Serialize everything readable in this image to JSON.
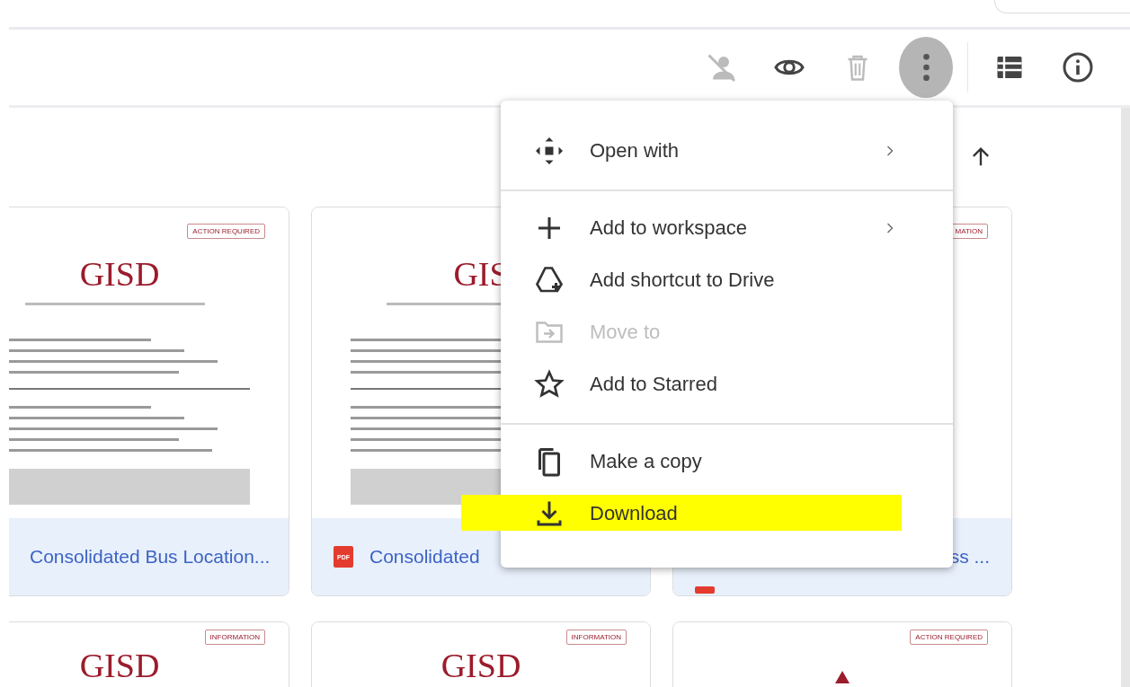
{
  "toolbar": {
    "buttons": [
      {
        "kind": "person-off",
        "disabled": true,
        "active": false
      },
      {
        "kind": "eye",
        "disabled": false,
        "active": false
      },
      {
        "kind": "trash",
        "disabled": true,
        "active": false
      },
      {
        "kind": "more",
        "disabled": false,
        "active": true
      },
      {
        "kind": "list",
        "disabled": false,
        "active": false
      },
      {
        "kind": "info",
        "disabled": false,
        "active": false
      }
    ]
  },
  "sort": {
    "kind": "ascending"
  },
  "files": [
    {
      "title": "Consolidated Bus Location...",
      "badge": "ACTION REQUIRED",
      "logo": "GISD"
    },
    {
      "title": "Consolidated",
      "logo": "GIS",
      "kind": "pdf",
      "file_icon": "PDF"
    },
    {
      "title": "ss ...",
      "badge": "MATION",
      "kind": "pdf"
    },
    {
      "badge": "INFORMATION",
      "logo": "GISD"
    },
    {
      "badge": "INFORMATION",
      "logo": "GISD"
    },
    {
      "badge": "ACTION REQUIRED",
      "logo_mark": true
    }
  ],
  "menu": {
    "items": [
      {
        "kind": "open-with",
        "label": "Open with",
        "submenu": true,
        "disabled": false,
        "highlighted": false
      },
      {
        "kind": "divider"
      },
      {
        "kind": "plus",
        "label": "Add to workspace",
        "submenu": true,
        "disabled": false,
        "highlighted": false
      },
      {
        "kind": "shortcut",
        "label": "Add shortcut to Drive",
        "submenu": false,
        "disabled": false,
        "highlighted": false
      },
      {
        "kind": "move",
        "label": "Move to",
        "submenu": false,
        "disabled": true,
        "highlighted": false
      },
      {
        "kind": "star",
        "label": "Add to Starred",
        "submenu": false,
        "disabled": false,
        "highlighted": false
      },
      {
        "kind": "divider"
      },
      {
        "kind": "copy",
        "label": "Make a copy",
        "submenu": false,
        "disabled": false,
        "highlighted": false
      },
      {
        "kind": "download",
        "label": "Download",
        "submenu": false,
        "disabled": false,
        "highlighted": true
      }
    ]
  }
}
